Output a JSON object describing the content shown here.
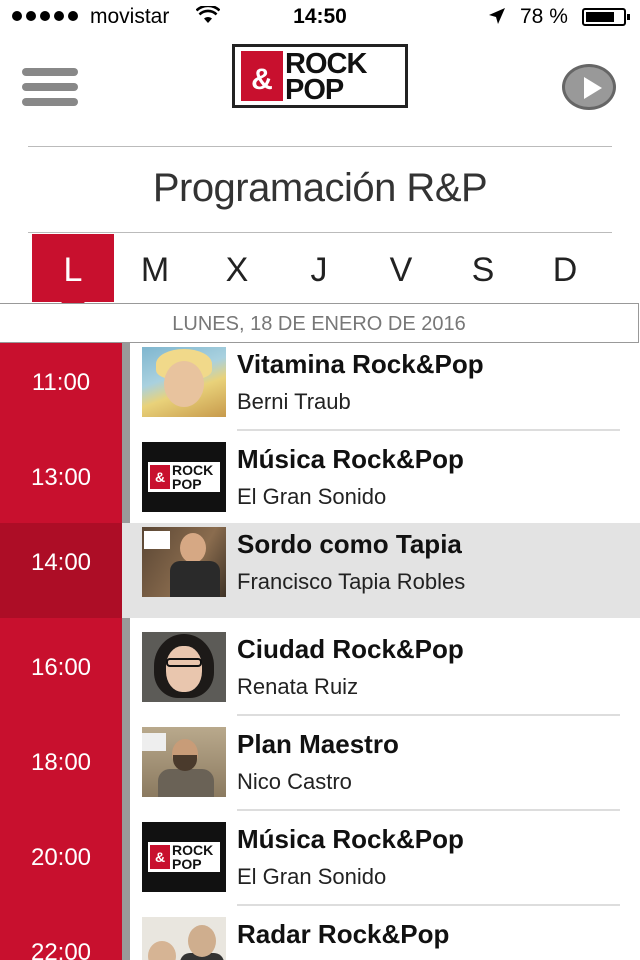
{
  "status_bar": {
    "carrier": "movistar",
    "time": "14:50",
    "battery_text": "78 %",
    "battery_level": 0.78,
    "icons": [
      "signal-dots-icon",
      "wifi-icon",
      "location-arrow-icon",
      "battery-icon"
    ]
  },
  "header": {
    "logo": {
      "amp": "&",
      "line1": "ROCK",
      "line2": "POP"
    },
    "menu_icon": "hamburger-menu-icon",
    "play_icon": "play-icon"
  },
  "page_title": "Programación R&P",
  "days": {
    "labels": [
      "L",
      "M",
      "X",
      "J",
      "V",
      "S",
      "D"
    ],
    "selected": "L"
  },
  "date_label": "LUNES, 18 DE ENERO DE 2016",
  "schedule": [
    {
      "time": "11:00",
      "title": "Vitamina Rock&Pop",
      "host": "Berni Traub",
      "thumbnail": "host-photo"
    },
    {
      "time": "13:00",
      "title": "Música Rock&Pop",
      "host": "El Gran Sonido",
      "thumbnail": "rock-pop-logo"
    },
    {
      "time": "14:00",
      "title": "Sordo como Tapia",
      "host": "Francisco Tapia Robles",
      "thumbnail": "host-photo",
      "current": true
    },
    {
      "time": "16:00",
      "title": "Ciudad Rock&Pop",
      "host": "Renata Ruiz",
      "thumbnail": "host-photo"
    },
    {
      "time": "18:00",
      "title": "Plan Maestro",
      "host": "Nico Castro",
      "thumbnail": "host-photo"
    },
    {
      "time": "20:00",
      "title": "Música Rock&Pop",
      "host": "El Gran Sonido",
      "thumbnail": "rock-pop-logo"
    },
    {
      "time": "22:00",
      "title": "Radar Rock&Pop",
      "host": "",
      "thumbnail": "host-photo"
    }
  ],
  "colors": {
    "brand_red": "#c8102e",
    "current_row_bg": "#e3e3e3",
    "text_gray": "#777777"
  }
}
